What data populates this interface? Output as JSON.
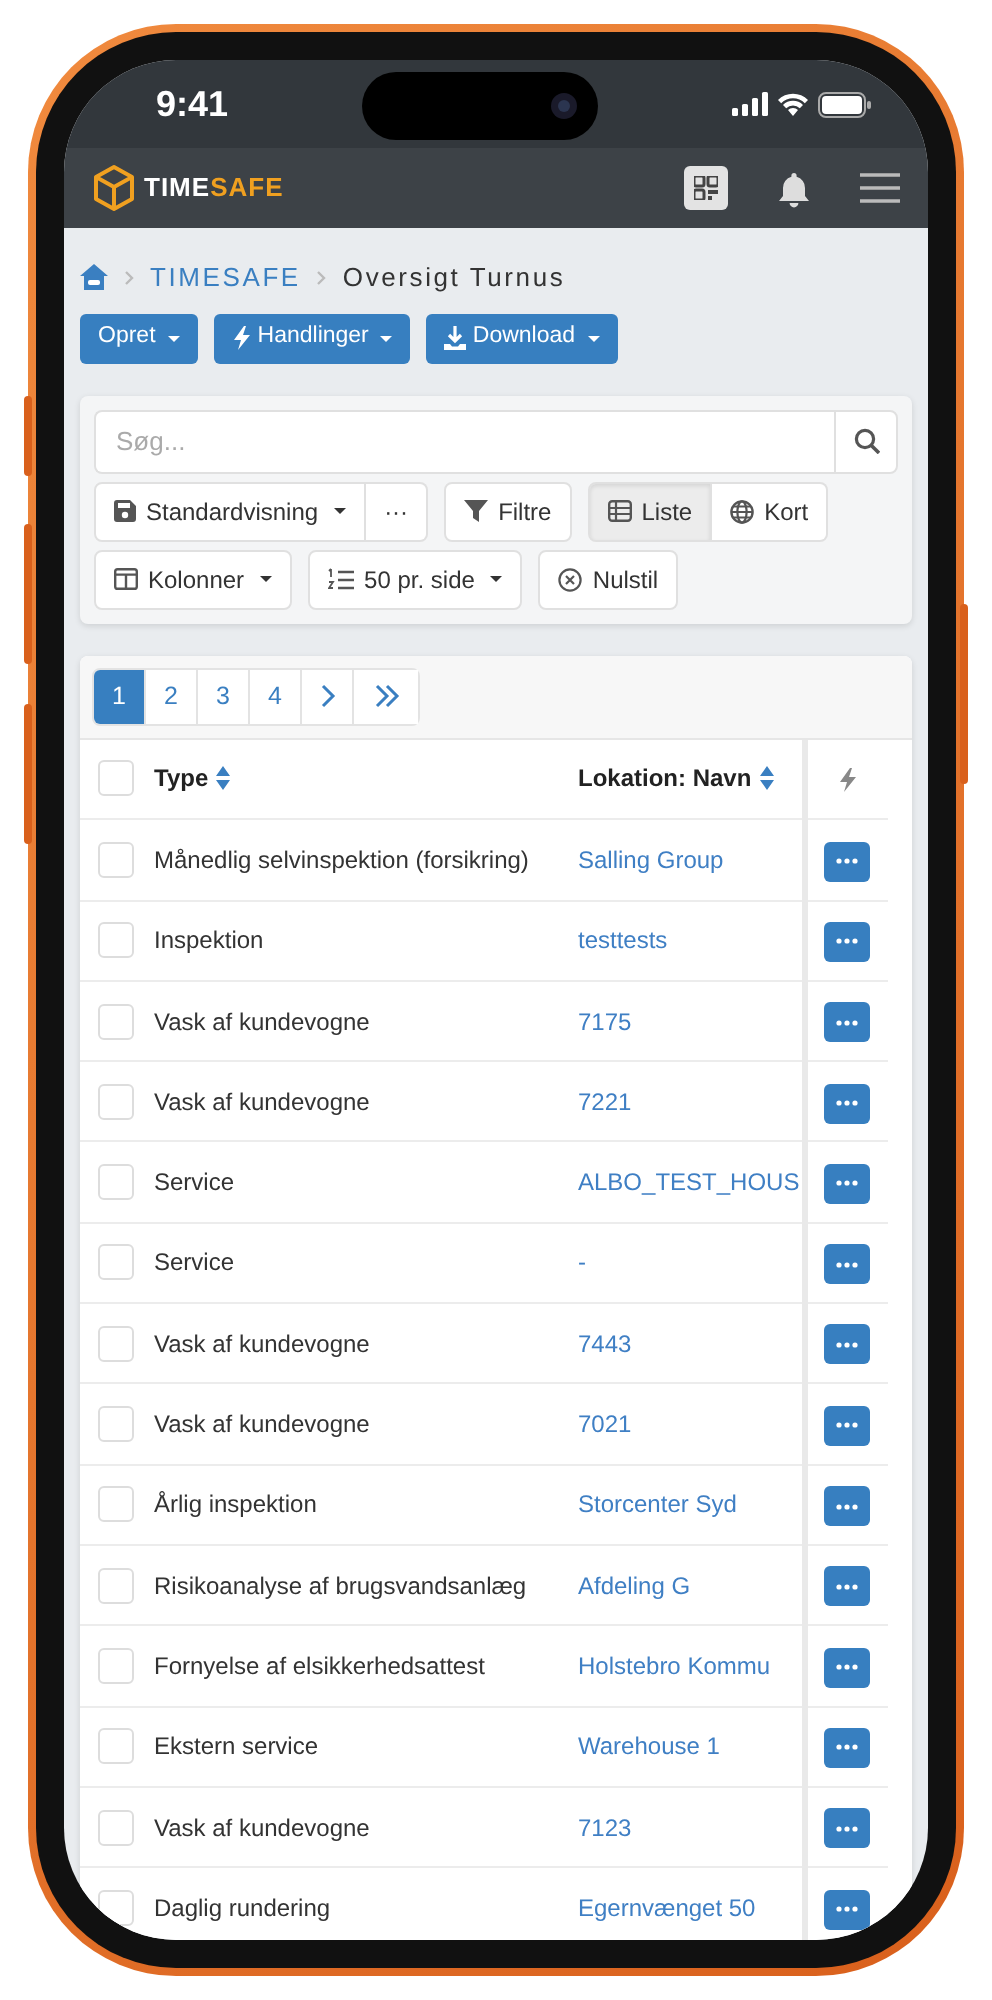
{
  "status_bar": {
    "time": "9:41"
  },
  "navbar": {
    "brand_prefix": "TIME",
    "brand_suffix": "SAFE"
  },
  "breadcrumb": [
    {
      "label": "TIMESAFE",
      "link": true
    },
    {
      "label": "Oversigt Turnus",
      "link": false
    }
  ],
  "action_buttons": [
    {
      "label": "Opret",
      "kind": "plain"
    },
    {
      "label": "Handlinger",
      "kind": "bolt"
    },
    {
      "label": "Download",
      "kind": "download"
    }
  ],
  "search": {
    "placeholder": "Søg..."
  },
  "toolbar_rows": [
    [
      {
        "buttons": [
          {
            "kind": "save",
            "label": "Standardvisning",
            "dropdown": true
          },
          {
            "kind": "plain",
            "label": "···",
            "dropdown": false
          }
        ]
      },
      {
        "buttons": [
          {
            "kind": "filter",
            "label": "Filtre",
            "dropdown": false
          }
        ]
      },
      {
        "buttons": [
          {
            "kind": "list",
            "label": "Liste",
            "dropdown": false,
            "selected": true
          },
          {
            "kind": "globe",
            "label": "Kort",
            "dropdown": false,
            "selected": false
          }
        ]
      }
    ],
    [
      {
        "buttons": [
          {
            "kind": "columns",
            "label": "Kolonner",
            "dropdown": true
          }
        ]
      },
      {
        "buttons": [
          {
            "kind": "numbered",
            "label": "50 pr. side",
            "dropdown": true
          }
        ]
      },
      {
        "buttons": [
          {
            "kind": "reset",
            "label": "Nulstil",
            "dropdown": false
          }
        ]
      }
    ]
  ],
  "pagination": {
    "pages": [
      {
        "label": "1",
        "selected": true
      },
      {
        "label": "2",
        "selected": false
      },
      {
        "label": "3",
        "selected": false
      },
      {
        "label": "4",
        "selected": false
      }
    ]
  },
  "table": {
    "select_all_checked": false,
    "columns": [
      {
        "label": "Type",
        "sortable": true
      },
      {
        "label": "Lokation: Navn",
        "sortable": true
      }
    ],
    "rows": [
      {
        "type": "Månedlig selvinspektion (forsikring)",
        "location": "Salling Group",
        "checked": false
      },
      {
        "type": "Inspektion",
        "location": "testtests",
        "checked": false
      },
      {
        "type": "Vask af kundevogne",
        "location": "7175",
        "checked": false
      },
      {
        "type": "Vask af kundevogne",
        "location": "7221",
        "checked": false
      },
      {
        "type": "Service",
        "location": "ALBO_TEST_HOUS",
        "checked": false
      },
      {
        "type": "Service",
        "location": "-",
        "checked": false
      },
      {
        "type": "Vask af kundevogne",
        "location": "7443",
        "checked": false
      },
      {
        "type": "Vask af kundevogne",
        "location": "7021",
        "checked": false
      },
      {
        "type": "Årlig inspektion",
        "location": "Storcenter Syd",
        "checked": false
      },
      {
        "type": "Risikoanalyse af brugsvandsanlæg",
        "location": "Afdeling G",
        "checked": false
      },
      {
        "type": "Fornyelse af elsikkerhedsattest",
        "location": "Holstebro Kommu",
        "checked": false
      },
      {
        "type": "Ekstern service",
        "location": "Warehouse 1",
        "checked": false
      },
      {
        "type": "Vask af kundevogne",
        "location": "7123",
        "checked": false
      },
      {
        "type": "Daglig rundering",
        "location": "Egernvænget 50",
        "checked": false
      }
    ]
  }
}
